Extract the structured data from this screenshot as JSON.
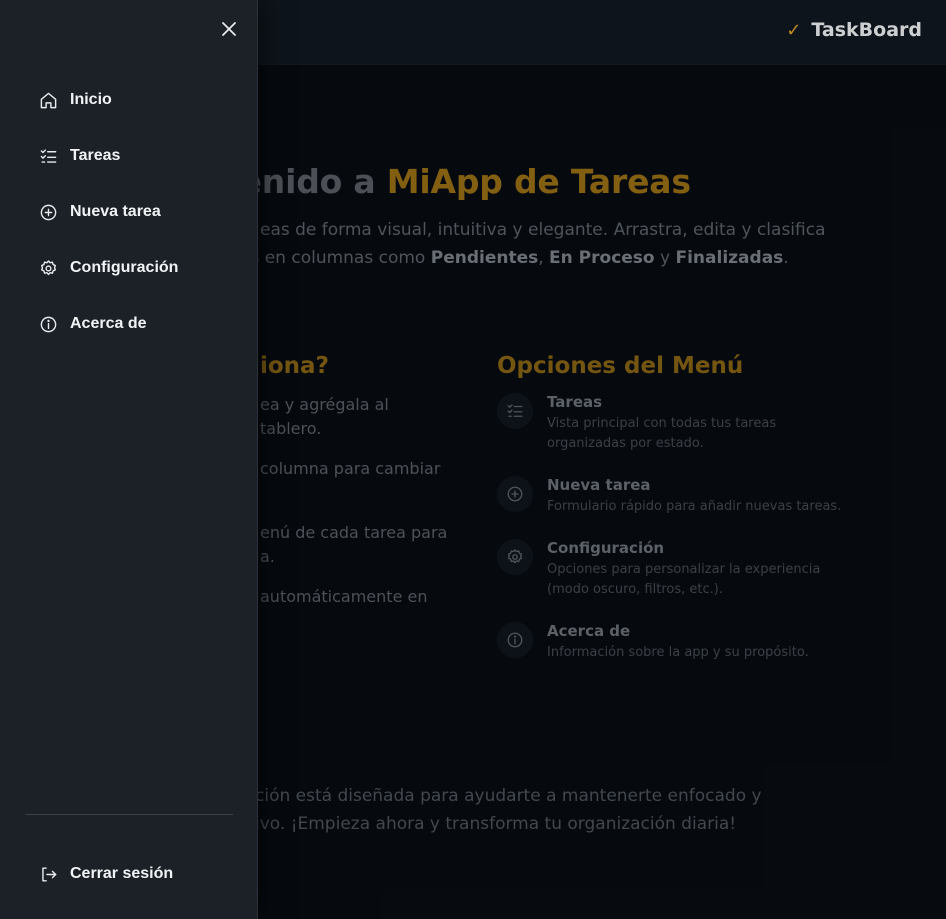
{
  "header": {
    "brand": "TaskBoard",
    "brand_icon": "check-icon",
    "accent_color": "#e0a52a"
  },
  "hero": {
    "title_visible": "nvenido a",
    "title_accent": "MiApp de Tareas",
    "sub_line1": "eas de forma visual, intuitiva y elegante. Arrastra, edita y clasifica",
    "sub_line2_pre": "es en columnas como",
    "status_1": "Pendientes",
    "status_2": "En Proceso",
    "conj": "y",
    "status_3": "Finalizadas"
  },
  "how": {
    "title_visible": "iona?",
    "steps": [
      "ea y agrégala al tablero.",
      "columna para cambiar",
      "enú de cada tarea para",
      "a.",
      "automáticamente en"
    ]
  },
  "menu_options": {
    "title": "Opciones del Menú",
    "items": [
      {
        "icon": "list-check-icon",
        "title": "Tareas",
        "desc": "Vista principal con todas tus tareas organizadas por estado."
      },
      {
        "icon": "plus-circle-icon",
        "title": "Nueva tarea",
        "desc": "Formulario rápido para añadir nuevas tareas."
      },
      {
        "icon": "gear-icon",
        "title": "Configuración",
        "desc": "Opciones para personalizar la experiencia (modo oscuro, filtros, etc.)."
      },
      {
        "icon": "info-icon",
        "title": "Acerca de",
        "desc": "Información sobre la app y su propósito."
      }
    ]
  },
  "footer": {
    "line1": "ción está diseñada para ayudarte a mantenerte enfocado y",
    "line2": "ivo. ¡Empieza ahora y transforma tu organización diaria!"
  },
  "sidebar": {
    "close_icon": "close-icon",
    "items": [
      {
        "icon": "home-icon",
        "label": "Inicio"
      },
      {
        "icon": "list-check-icon",
        "label": "Tareas"
      },
      {
        "icon": "plus-circle-icon",
        "label": "Nueva tarea"
      },
      {
        "icon": "gear-icon",
        "label": "Configuración"
      },
      {
        "icon": "info-icon",
        "label": "Acerca de"
      }
    ],
    "logout": {
      "icon": "logout-icon",
      "label": "Cerrar sesión"
    }
  }
}
